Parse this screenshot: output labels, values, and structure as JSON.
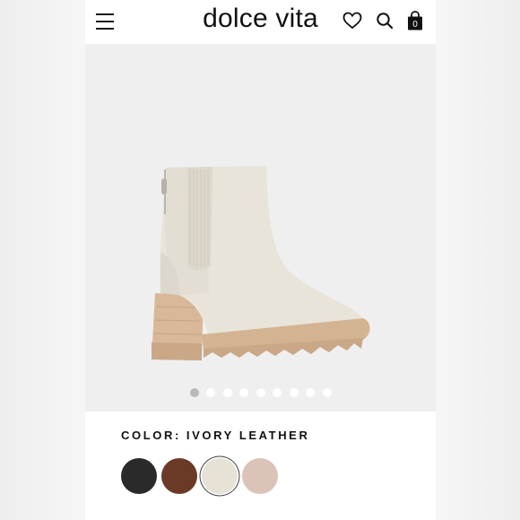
{
  "header": {
    "brand": "dolce vita",
    "cart_count": "0",
    "icons": [
      "menu-icon",
      "heart-icon",
      "search-icon",
      "shopping-bag-icon"
    ]
  },
  "gallery": {
    "image_description": "ivory leather chelsea ankle boot with lug sole",
    "slide_count": 9,
    "active_slide": 1
  },
  "color": {
    "label": "COLOR:",
    "value": "IVORY LEATHER",
    "swatches": [
      {
        "name": "black",
        "hex": "#2a2a2a"
      },
      {
        "name": "brown",
        "hex": "#6b3a26"
      },
      {
        "name": "ivory",
        "hex": "#e7e2d6",
        "selected": true
      },
      {
        "name": "blush",
        "hex": "#dbc3b7"
      }
    ]
  }
}
